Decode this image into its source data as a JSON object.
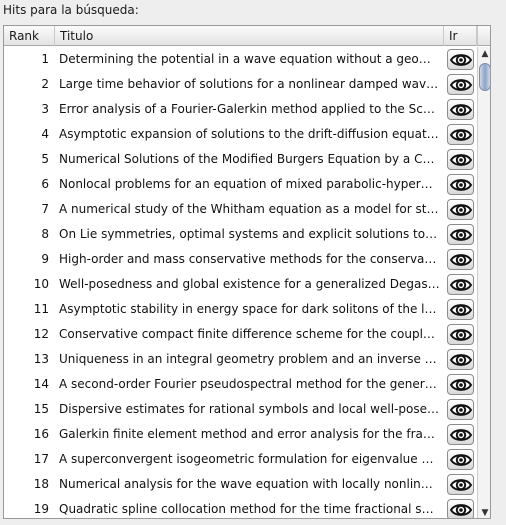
{
  "label": "Hits para la búsqueda:",
  "table": {
    "columns": {
      "rank": "Rank",
      "title": "Titulo",
      "go": "Ir"
    },
    "rows": [
      {
        "rank": "1",
        "title": "Determining the potential in a wave equation without a geometr..."
      },
      {
        "rank": "2",
        "title": "Large time behavior of solutions for a nonlinear damped wave ..."
      },
      {
        "rank": "3",
        "title": "Error analysis of a Fourier-Galerkin method applied to the Schr..."
      },
      {
        "rank": "4",
        "title": "Asymptotic expansion of solutions to the drift-diffusion equatio..."
      },
      {
        "rank": "5",
        "title": "Numerical Solutions of the Modified Burgers Equation by a Cubi..."
      },
      {
        "rank": "6",
        "title": "Nonlocal problems for an equation of mixed parabolic-hyperbo..."
      },
      {
        "rank": "7",
        "title": "A numerical study of the Whitham equation as a model for stea..."
      },
      {
        "rank": "8",
        "title": "On Lie symmetries, optimal systems and explicit solutions to th..."
      },
      {
        "rank": "9",
        "title": "High-order and mass conservative methods for the conservativ..."
      },
      {
        "rank": "10",
        "title": "Well-posedness and global existence for a generalized Degasp..."
      },
      {
        "rank": "11",
        "title": "Asymptotic stability in energy space for dark solitons of the lan..."
      },
      {
        "rank": "12",
        "title": "Conservative compact finite difference scheme for the coupled ..."
      },
      {
        "rank": "13",
        "title": "Uniqueness in an integral geometry problem and an inverse pr..."
      },
      {
        "rank": "14",
        "title": "A second-order Fourier pseudospectral method for the general..."
      },
      {
        "rank": "15",
        "title": "Dispersive estimates for rational symbols and local well-posed..."
      },
      {
        "rank": "16",
        "title": "Galerkin finite element method and error analysis for the fractio..."
      },
      {
        "rank": "17",
        "title": "A superconvergent isogeometric formulation for eigenvalue com..."
      },
      {
        "rank": "18",
        "title": "Numerical analysis for the wave equation with locally nonlinear ..."
      },
      {
        "rank": "19",
        "title": "Quadratic spline collocation method for the time fractional subd..."
      }
    ]
  },
  "icons": {
    "go": "eye-icon",
    "scroll_up": "arrow-up-icon",
    "scroll_down": "arrow-down-icon"
  }
}
